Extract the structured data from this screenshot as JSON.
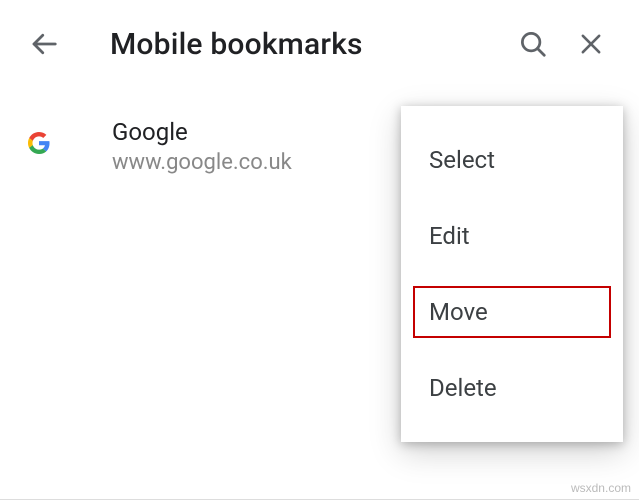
{
  "header": {
    "title": "Mobile bookmarks"
  },
  "bookmarks": [
    {
      "title": "Google",
      "url": "www.google.co.uk"
    }
  ],
  "menu": {
    "items": [
      {
        "label": "Select",
        "highlighted": false
      },
      {
        "label": "Edit",
        "highlighted": false
      },
      {
        "label": "Move",
        "highlighted": true
      },
      {
        "label": "Delete",
        "highlighted": false
      }
    ]
  },
  "watermark": "wsxdn.com"
}
